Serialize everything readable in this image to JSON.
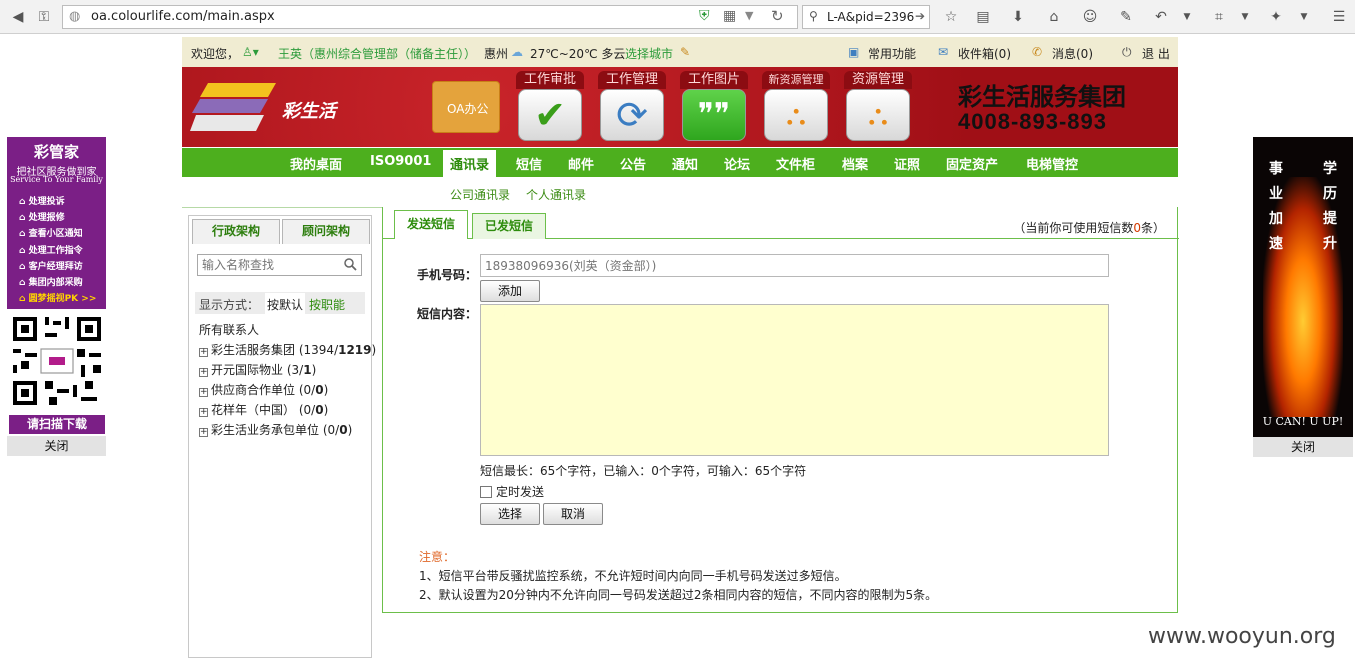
{
  "browser": {
    "url": "oa.colourlife.com/main.aspx",
    "search_value": "L-A&pid=2396"
  },
  "topbar": {
    "welcome": "欢迎您，",
    "user": "王英（惠州综合管理部（储备主任））",
    "city": "惠州",
    "weather": "27℃~20℃ 多云",
    "choose_city": "选择城市",
    "common_functions": "常用功能",
    "inbox": "收件箱(0)",
    "messages": "消息(0)",
    "logout": "退 出"
  },
  "banner": {
    "logo_text": "彩生活",
    "folder_label": "OA办公",
    "tiles": [
      {
        "label": "工作审批",
        "icon": "checkmark-icon"
      },
      {
        "label": "工作管理",
        "icon": "refresh-icon"
      },
      {
        "label": "工作图片",
        "icon": "wechat-icon"
      },
      {
        "label": "新资源管理",
        "icon": "org-chart-icon"
      },
      {
        "label": "资源管理",
        "icon": "org-chart-icon"
      }
    ],
    "company": "彩生活服务集团",
    "phone": "4008-893-893"
  },
  "nav": {
    "items": [
      "我的桌面",
      "ISO9001",
      "通讯录",
      "短信",
      "邮件",
      "公告",
      "通知",
      "论坛",
      "文件柜",
      "档案",
      "证照",
      "固定资产",
      "电梯管控"
    ],
    "active_index": 2
  },
  "subnav": {
    "items": [
      "公司通讯录",
      "个人通讯录"
    ]
  },
  "left": {
    "tabs": [
      "行政架构",
      "顾问架构"
    ],
    "search_placeholder": "输入名称查找",
    "display_mode_label": "显示方式：",
    "mode_default": "按默认",
    "mode_position": "按职能",
    "all_contacts": "所有联系人",
    "tree": [
      {
        "name": "彩生活服务集团",
        "count": "(1394/",
        "bold": "1219",
        "end": ")"
      },
      {
        "name": "开元国际物业",
        "count": "(3/",
        "bold": "1",
        "end": ")"
      },
      {
        "name": "供应商合作单位",
        "count": "(0/",
        "bold": "0",
        "end": ")"
      },
      {
        "name": "花样年（中国）",
        "count": "(0/",
        "bold": "0",
        "end": ")"
      },
      {
        "name": "彩生活业务承包单位",
        "count": "(0/",
        "bold": "0",
        "end": ")"
      }
    ]
  },
  "right": {
    "tabs": [
      "发送短信",
      "已发短信"
    ],
    "quota_prefix": "（当前你可使用短信数",
    "quota_value": "0",
    "quota_suffix": "条）",
    "phone_label": "手机号码：",
    "phone_placeholder": "18938096936(刘英（资金部）)",
    "add_button": "添加",
    "content_label": "短信内容：",
    "content_value": "",
    "counter": "短信最长：65个字符，已输入：0个字符，可输入：65个字符",
    "timed_send": "定时发送",
    "select_button": "选择",
    "cancel_button": "取消",
    "note_title": "注意：",
    "notes": [
      "1、短信平台带反骚扰监控系统，不允许短时间内向同一手机号码发送过多短信。",
      "2、默认设置为20分钟内不允许向同一号码发送超过2条相同内容的短信，不同内容的限制为5条。"
    ]
  },
  "ad_left": {
    "title": "彩管家",
    "subtitle": "把社区服务做到家",
    "subtitle_en": "Service To Your Family",
    "items": [
      "处理投诉",
      "处理报修",
      "查看小区通知",
      "处理工作指令",
      "客户经理拜访",
      "集团内部采购",
      "圆梦摇视PK >>"
    ],
    "scan": "请扫描下载",
    "close": "关闭"
  },
  "ad_right": {
    "col1": [
      "事",
      "业",
      "加",
      "速"
    ],
    "col2": [
      "学",
      "历",
      "提",
      "升"
    ],
    "slogan": "U CAN! U UP!",
    "close": "关闭"
  },
  "watermark": "www.wooyun.org",
  "colors": {
    "nav_green": "#4daf1e",
    "banner_red": "#b8141c",
    "ad_purple": "#7b1f86",
    "textarea_yellow": "#ffffcf"
  }
}
